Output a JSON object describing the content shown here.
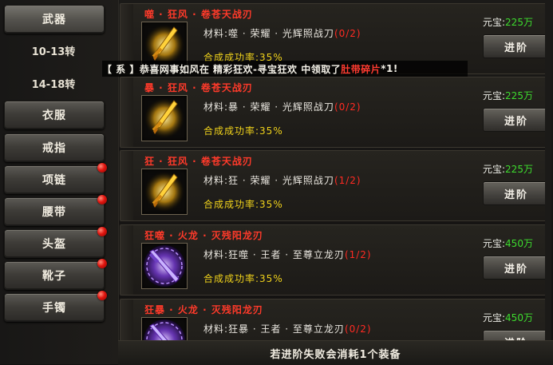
{
  "nav": {
    "items": [
      {
        "label": "武器",
        "active": true,
        "badge": false
      },
      {
        "label": "10-13转",
        "sub": true,
        "badge": false
      },
      {
        "label": "14-18转",
        "sub": true,
        "badge": false
      },
      {
        "label": "衣服",
        "badge": false
      },
      {
        "label": "戒指",
        "badge": false
      },
      {
        "label": "项链",
        "badge": true
      },
      {
        "label": "腰带",
        "badge": true
      },
      {
        "label": "头盔",
        "badge": true
      },
      {
        "label": "靴子",
        "badge": true
      },
      {
        "label": "手镯",
        "badge": true
      }
    ]
  },
  "notice": {
    "p1": "【 系 】恭喜网事如风在 精彩狂欢-寻宝狂欢 中领取了",
    "item": "肚带碎片",
    "p2": "*1!"
  },
  "cards": [
    {
      "title": "噬 · 狂风 · 卷苍天战刃",
      "material": "材料:噬 · 荣耀 · 光辉照战刀",
      "count": "(0/2)",
      "rate": "合成成功率:35%",
      "price_label": "元宝:",
      "price": "225万",
      "button": "进阶",
      "icon": "golden-sword-icon"
    },
    {
      "title": "暴 · 狂风 · 卷苍天战刃",
      "material": "材料:暴 · 荣耀 · 光辉照战刀",
      "count": "(0/2)",
      "rate": "合成成功率:35%",
      "price_label": "元宝:",
      "price": "225万",
      "button": "进阶",
      "icon": "golden-sword-icon"
    },
    {
      "title": "狂 · 狂风 · 卷苍天战刃",
      "material": "材料:狂 · 荣耀 · 光辉照战刀",
      "count": "(1/2)",
      "rate": "合成成功率:35%",
      "price_label": "元宝:",
      "price": "225万",
      "button": "进阶",
      "icon": "golden-sword-icon"
    },
    {
      "title": "狂噬 · 火龙 · 灭残阳龙刃",
      "material": "材料:狂噬 · 王者 · 至尊立龙刃",
      "count": "(1/2)",
      "rate": "合成成功率:35%",
      "price_label": "元宝:",
      "price": "450万",
      "button": "进阶",
      "icon": "purple-blade-icon"
    },
    {
      "title": "狂暴 · 火龙 · 灭残阳龙刃",
      "material": "材料:狂暴 · 王者 · 至尊立龙刃",
      "count": "(0/2)",
      "rate": "",
      "price_label": "元宝:",
      "price": "450万",
      "button": "进阶",
      "icon": "purple-blade-icon"
    }
  ],
  "footer": {
    "text": "若进阶失败会消耗1个装备"
  },
  "colors": {
    "title_red": "#ff3a2a",
    "count_red": "#ff2a22",
    "rate_yellow": "#f0d21b",
    "price_green": "#3ddc2e",
    "badge_red": "#e0140e"
  }
}
